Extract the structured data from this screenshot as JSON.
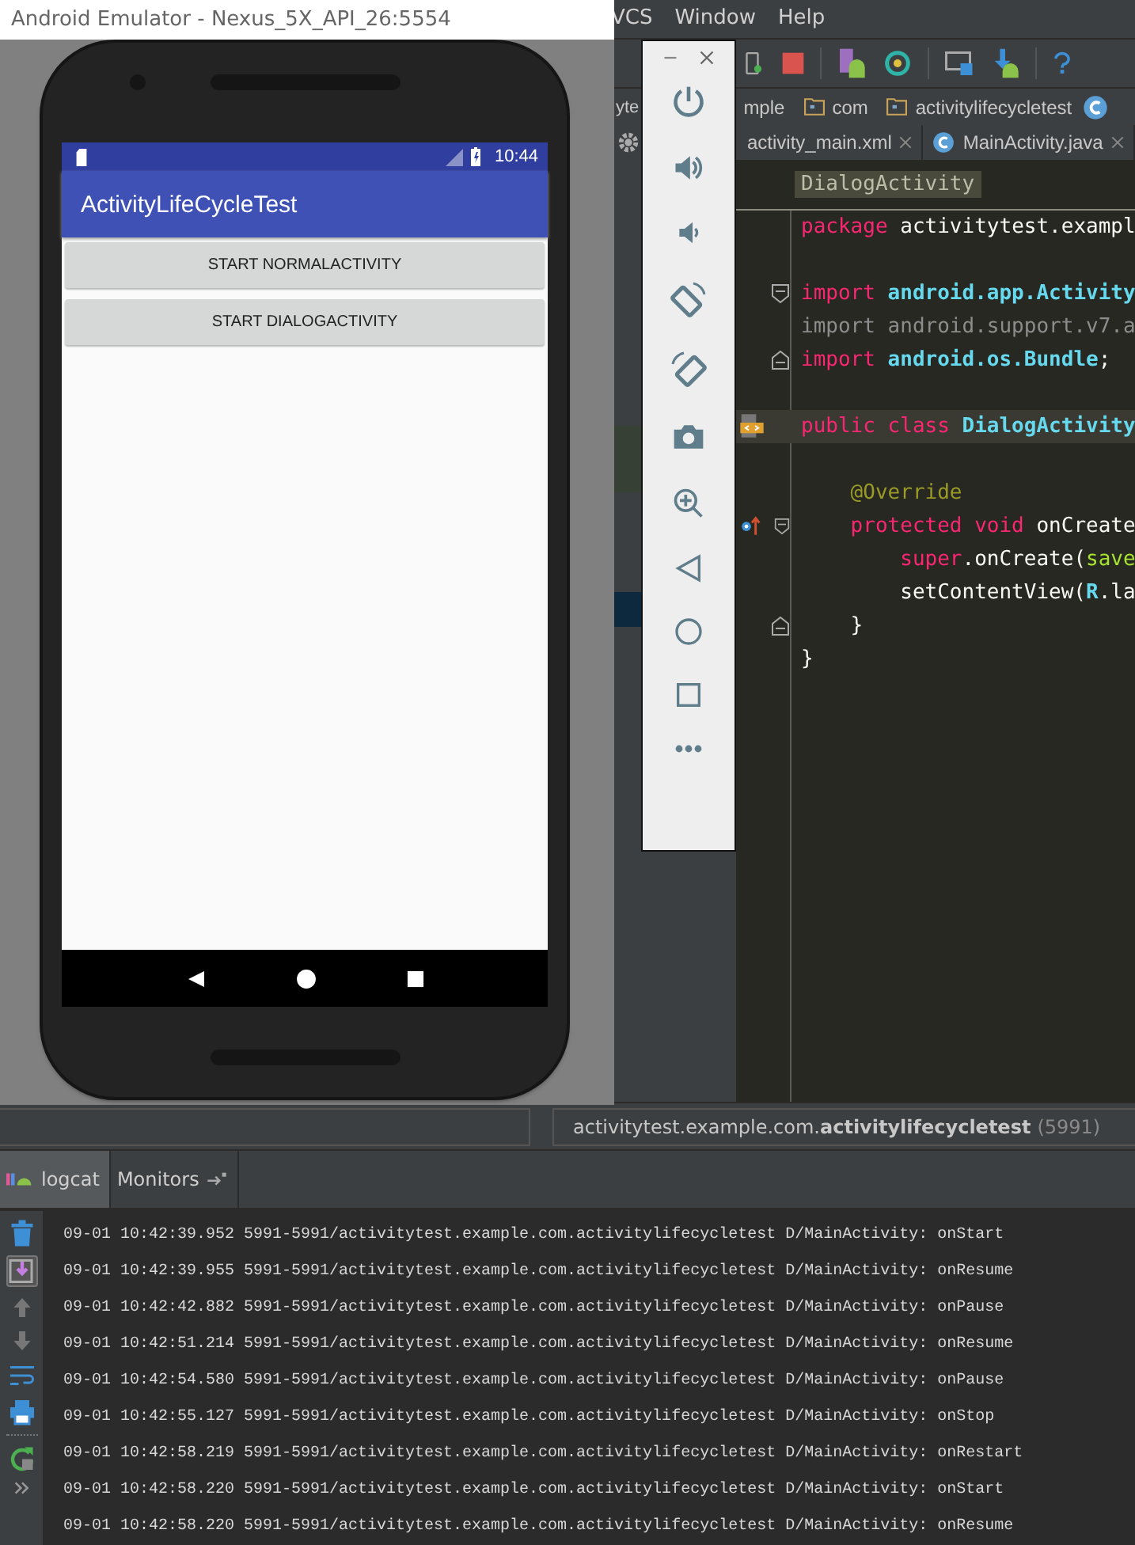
{
  "emulator": {
    "title": "Android Emulator - Nexus_5X_API_26:5554",
    "time": "10:44",
    "app_title": "ActivityLifeCycleTest",
    "buttons": [
      "START NORMALACTIVITY",
      "START DIALOGACTIVITY"
    ]
  },
  "ide": {
    "menu": [
      "VCS",
      "Window",
      "Help"
    ],
    "breadcrumb": [
      {
        "label": "yte",
        "kind": "plain"
      },
      {
        "label": "mple",
        "kind": "plain"
      },
      {
        "label": "com",
        "kind": "folder"
      },
      {
        "label": "activitylifecycletest",
        "kind": "folder"
      }
    ],
    "editor_tabs": [
      {
        "label": "activity_main.xml",
        "selected": false
      },
      {
        "label": "MainActivity.java",
        "selected": false
      }
    ],
    "structure_label": "DialogActivity",
    "code": [
      {
        "kind": "code",
        "tokens": [
          {
            "kind": "keyword",
            "text": "package"
          },
          {
            "kind": "plain",
            "text": " activitytest.exampl"
          }
        ]
      },
      {
        "kind": "blank"
      },
      {
        "kind": "code",
        "gutter": [
          {
            "kind": "fold_start"
          }
        ],
        "tokens": [
          {
            "kind": "keyword",
            "text": "import"
          },
          {
            "kind": "type",
            "text": " android.app.Activity"
          }
        ]
      },
      {
        "kind": "code",
        "tokens": [
          {
            "kind": "unused",
            "text": "import android.support.v7.a"
          }
        ]
      },
      {
        "kind": "code",
        "gutter": [
          {
            "kind": "fold_end"
          }
        ],
        "tokens": [
          {
            "kind": "keyword",
            "text": "import"
          },
          {
            "kind": "type",
            "text": " android.os.Bundle"
          },
          {
            "kind": "plain",
            "text": ";"
          }
        ]
      },
      {
        "kind": "blank"
      },
      {
        "kind": "code",
        "highlighted": true,
        "gutter": [
          {
            "kind": "class"
          }
        ],
        "tokens": [
          {
            "kind": "keyword",
            "text": "public class"
          },
          {
            "kind": "type",
            "text": " DialogActivity"
          }
        ]
      },
      {
        "kind": "blank"
      },
      {
        "kind": "code",
        "tokens": [
          {
            "kind": "annotation",
            "text": "    @Override"
          }
        ]
      },
      {
        "kind": "code",
        "gutter": [
          {
            "kind": "override"
          },
          {
            "kind": "fold_start"
          }
        ],
        "tokens": [
          {
            "kind": "keyword",
            "text": "    protected void"
          },
          {
            "kind": "plain",
            "text": " onCreate"
          }
        ]
      },
      {
        "kind": "code",
        "tokens": [
          {
            "kind": "keyword",
            "text": "        super"
          },
          {
            "kind": "plain",
            "text": ".onCreate("
          },
          {
            "kind": "param",
            "text": "save"
          }
        ]
      },
      {
        "kind": "code",
        "tokens": [
          {
            "kind": "plain",
            "text": "        setContentView("
          },
          {
            "kind": "type",
            "text": "R"
          },
          {
            "kind": "plain",
            "text": ".la"
          }
        ]
      },
      {
        "kind": "code",
        "gutter": [
          {
            "kind": "fold_end"
          }
        ],
        "tokens": [
          {
            "kind": "plain",
            "text": "    }"
          }
        ]
      },
      {
        "kind": "code",
        "tokens": [
          {
            "kind": "plain",
            "text": "}"
          }
        ]
      }
    ],
    "process": {
      "name": "activitytest.example.com.**activitylifecycletest**",
      "pid": "(5991)"
    },
    "tool_tabs": [
      {
        "label": "logcat",
        "selected": true
      },
      {
        "label": "Monitors",
        "selected": false
      }
    ],
    "log": [
      "09-01 10:42:39.952 5991-5991/activitytest.example.com.activitylifecycletest D/MainActivity: onStart",
      "09-01 10:42:39.955 5991-5991/activitytest.example.com.activitylifecycletest D/MainActivity: onResume",
      "09-01 10:42:42.882 5991-5991/activitytest.example.com.activitylifecycletest D/MainActivity: onPause",
      "09-01 10:42:51.214 5991-5991/activitytest.example.com.activitylifecycletest D/MainActivity: onResume",
      "09-01 10:42:54.580 5991-5991/activitytest.example.com.activitylifecycletest D/MainActivity: onPause",
      "09-01 10:42:55.127 5991-5991/activitytest.example.com.activitylifecycletest D/MainActivity: onStop",
      "09-01 10:42:58.219 5991-5991/activitytest.example.com.activitylifecycletest D/MainActivity: onRestart",
      "09-01 10:42:58.220 5991-5991/activitytest.example.com.activitylifecycletest D/MainActivity: onStart",
      "09-01 10:42:58.220 5991-5991/activitytest.example.com.activitylifecycletest D/MainActivity: onResume"
    ]
  }
}
